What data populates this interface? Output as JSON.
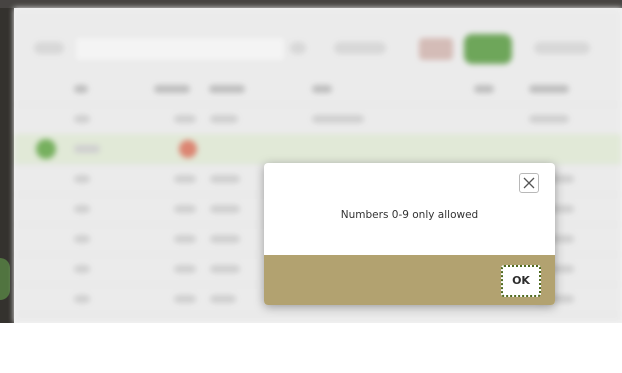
{
  "dialog": {
    "message": "Numbers 0-9 only allowed",
    "ok_label": "OK",
    "close_icon": "close-icon"
  },
  "colors": {
    "dialog_footer": "#b2a270",
    "ok_focus_outline": "#4f6a1f",
    "selected_row": "#dde6d2",
    "accent_green": "#64a548"
  }
}
